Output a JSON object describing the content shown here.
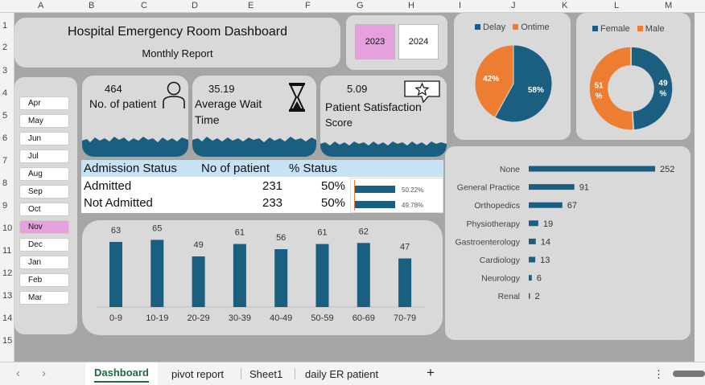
{
  "columns": [
    "A",
    "B",
    "C",
    "D",
    "E",
    "F",
    "G",
    "H",
    "I",
    "J",
    "K",
    "L",
    "M"
  ],
  "rows": [
    "1",
    "2",
    "3",
    "4",
    "5",
    "6",
    "7",
    "8",
    "9",
    "10",
    "11",
    "12",
    "13",
    "14",
    "15"
  ],
  "header": {
    "title": "Hospital Emergency Room Dashboard",
    "subtitle": "Monthly Report"
  },
  "years": [
    "2023",
    "2024"
  ],
  "selected_year": "2023",
  "months": [
    "Apr",
    "May",
    "Jun",
    "Jul",
    "Aug",
    "Sep",
    "Oct",
    "Nov",
    "Dec",
    "Jan",
    "Feb",
    "Mar"
  ],
  "selected_month": "Nov",
  "kpis": {
    "patients": {
      "value": "464",
      "label": "No. of patient"
    },
    "wait": {
      "value": "35.19",
      "label1": "Average Wait",
      "label2": "Time"
    },
    "satisfaction": {
      "value": "5.09",
      "label1": "Patient Satisfaction",
      "label2": "Score"
    }
  },
  "admission": {
    "headers": [
      "Admission Status",
      "No of patient",
      "% Status"
    ],
    "rows": [
      {
        "status": "Admitted",
        "count": "231",
        "pct": "50%",
        "spark": "50.22%",
        "frac": 0.5022
      },
      {
        "status": "Not Admitted",
        "count": "233",
        "pct": "50%",
        "spark": "49.78%",
        "frac": 0.4978
      }
    ]
  },
  "colors": {
    "teal": "#1a5e80",
    "orange": "#ed7d31",
    "panel": "#d9d9d9",
    "sheet": "#a6a6a6",
    "pink": "#e6a0e0"
  },
  "chart_data": [
    {
      "type": "bar",
      "categories": [
        "0-9",
        "10-19",
        "20-29",
        "30-39",
        "40-49",
        "50-59",
        "60-69",
        "70-79"
      ],
      "values": [
        63,
        65,
        49,
        61,
        56,
        61,
        62,
        47
      ],
      "ylim": [
        0,
        70
      ],
      "color": "#1a5e80"
    },
    {
      "type": "pie",
      "labels": [
        "Delay",
        "Ontime"
      ],
      "values": [
        58,
        42
      ],
      "display": [
        "58%",
        "42%"
      ],
      "colors": [
        "#1a5e80",
        "#ed7d31"
      ],
      "legend": "top"
    },
    {
      "type": "pie",
      "style": "donut",
      "labels": [
        "Female",
        "Male"
      ],
      "values": [
        49,
        51
      ],
      "display": [
        [
          "49",
          "%"
        ],
        [
          "51",
          "%"
        ]
      ],
      "colors": [
        "#1a5e80",
        "#ed7d31"
      ],
      "legend": "top"
    },
    {
      "type": "bar",
      "orientation": "horizontal",
      "categories": [
        "None",
        "General Practice",
        "Orthopedics",
        "Physiotherapy",
        "Gastroenterology",
        "Cardiology",
        "Neurology",
        "Renal"
      ],
      "values": [
        252,
        91,
        67,
        19,
        14,
        13,
        6,
        2
      ],
      "color": "#1a5e80"
    }
  ],
  "tabs": [
    {
      "label": "Dashboard",
      "active": true
    },
    {
      "label": "pivot report",
      "active": false
    },
    {
      "label": "Sheet1",
      "active": false
    },
    {
      "label": "daily ER patient",
      "active": false
    }
  ],
  "add_sheet": "+",
  "nav": {
    "prev": "‹",
    "next": "›",
    "more": "⋮"
  }
}
